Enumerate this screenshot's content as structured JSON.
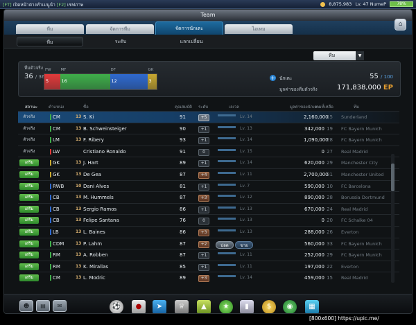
{
  "topbar": {
    "left_tag": "[FT]",
    "left_text": "เปิดหน้าต่างทำเมนูนำ",
    "left_tag2": "[F2]",
    "left_text2": "เซฟภาพ",
    "coins": "8,875,983",
    "level": "Lv. 47 NumeP",
    "battery": "78%"
  },
  "window": {
    "title": "Team"
  },
  "main_tabs": [
    "ทีม",
    "จัดการทีม",
    "จัดการนักเตะ",
    "ไอเทม"
  ],
  "sub_tabs": [
    "ทีม",
    "ระดับ",
    "แลกเปลี่ยน"
  ],
  "team_select": {
    "value": "ทีม"
  },
  "summary": {
    "squad_label": "ทีมตัวจริง",
    "squad_count": "36",
    "squad_max": "/ 36",
    "positions": [
      {
        "label": "FW",
        "count": "5",
        "color": "#e23a3a"
      },
      {
        "label": "MF",
        "count": "16",
        "color": "#3fae4a"
      },
      {
        "label": "DF",
        "count": "12",
        "color": "#2f6ad0"
      },
      {
        "label": "GK",
        "count": "3",
        "color": "#c8a830"
      }
    ],
    "player_label": "นักเตะ",
    "player_count": "55",
    "player_max": "/ 100",
    "value_label": "มูลค่าของทีมตัวจริง",
    "value": "171,838,000",
    "value_unit": "EP"
  },
  "table": {
    "headers": {
      "status": "สถานะ",
      "position": "ตำแหน่ง",
      "name": "ชื่อ",
      "ovr": "คุณสมบัติ",
      "level": "ระดับ",
      "exp": "เลเวล",
      "price": "มูลค่าของนักเตะ",
      "season": "เกมที่เหลือ",
      "club": "ทีม"
    },
    "actions": {
      "cancel": "ปลด",
      "sell": "ขาย"
    },
    "rows": [
      {
        "status": "ตัวจริง",
        "pos": "CM",
        "flag": "13",
        "name": "S. Ki",
        "ovr": "91",
        "lvl": "+5",
        "lvl_type": "max",
        "exp": "Lv. 14",
        "price": "2,160,000",
        "season": "15",
        "club": "Sunderland",
        "pos_color": "#3fae4a",
        "selected": true
      },
      {
        "status": "ตัวจริง",
        "pos": "CM",
        "flag": "13",
        "name": "B. Schweinsteiger",
        "ovr": "90",
        "lvl": "+1",
        "lvl_type": "",
        "exp": "Lv. 13",
        "price": "342,000",
        "season": "19",
        "club": "FC Bayern Munich",
        "pos_color": "#3fae4a"
      },
      {
        "status": "ตัวจริง",
        "pos": "LM",
        "flag": "13",
        "name": "F. Ribery",
        "ovr": "93",
        "lvl": "+1",
        "lvl_type": "",
        "exp": "Lv. 14",
        "price": "1,090,000",
        "season": "28",
        "club": "FC Bayern Munich",
        "pos_color": "#3fae4a"
      },
      {
        "status": "ตัวจริง",
        "pos": "LW",
        "flag": "",
        "name": "Cristiano Ronaldo",
        "ovr": "91",
        "lvl": "0",
        "lvl_type": "",
        "exp": "Lv. 15",
        "price": "0",
        "season": "27",
        "club": "Real Madrid",
        "pos_color": "#e23a3a"
      },
      {
        "status": "เสริม",
        "pos": "GK",
        "flag": "13",
        "name": "J. Hart",
        "ovr": "89",
        "lvl": "+1",
        "lvl_type": "",
        "exp": "Lv. 14",
        "price": "620,000",
        "season": "29",
        "club": "Manchester City",
        "pos_color": "#c8a830"
      },
      {
        "status": "เสริม",
        "pos": "GK",
        "flag": "13",
        "name": "De Gea",
        "ovr": "87",
        "lvl": "+4",
        "lvl_type": "hi",
        "exp": "Lv. 11",
        "price": "2,700,000",
        "season": "31",
        "club": "Manchester United",
        "pos_color": "#c8a830"
      },
      {
        "status": "เสริม",
        "pos": "RWB",
        "flag": "10",
        "name": "Dani Alves",
        "ovr": "81",
        "lvl": "+1",
        "lvl_type": "",
        "exp": "Lv. 7",
        "price": "590,000",
        "season": "10",
        "club": "FC Barcelona",
        "pos_color": "#2f6ad0"
      },
      {
        "status": "เสริม",
        "pos": "CB",
        "flag": "13",
        "name": "M. Hummels",
        "ovr": "87",
        "lvl": "+3",
        "lvl_type": "hi",
        "exp": "Lv. 12",
        "price": "890,000",
        "season": "28",
        "club": "Borussia Dortmund",
        "pos_color": "#2f6ad0"
      },
      {
        "status": "เสริม",
        "pos": "CB",
        "flag": "13",
        "name": "Sergio Ramos",
        "ovr": "86",
        "lvl": "+1",
        "lvl_type": "",
        "exp": "Lv. 13",
        "price": "670,000",
        "season": "24",
        "club": "Real Madrid",
        "pos_color": "#2f6ad0"
      },
      {
        "status": "เสริม",
        "pos": "CB",
        "flag": "13",
        "name": "Felipe Santana",
        "ovr": "76",
        "lvl": "0",
        "lvl_type": "",
        "exp": "Lv. 13",
        "price": "0",
        "season": "20",
        "club": "FC Schalke 04",
        "pos_color": "#2f6ad0"
      },
      {
        "status": "เสริม",
        "pos": "LB",
        "flag": "13",
        "name": "L. Baines",
        "ovr": "86",
        "lvl": "+3",
        "lvl_type": "hi",
        "exp": "Lv. 13",
        "price": "288,000",
        "season": "26",
        "club": "Everton",
        "pos_color": "#2f6ad0"
      },
      {
        "status": "เสริม",
        "pos": "CDM",
        "flag": "13",
        "name": "P. Lahm",
        "ovr": "87",
        "lvl": "+2",
        "lvl_type": "hi",
        "exp": "",
        "price": "560,000",
        "season": "33",
        "club": "FC Bayern Munich",
        "pos_color": "#3fae4a",
        "actions": true
      },
      {
        "status": "เสริม",
        "pos": "RM",
        "flag": "13",
        "name": "A. Robben",
        "ovr": "87",
        "lvl": "+1",
        "lvl_type": "",
        "exp": "Lv. 11",
        "price": "252,000",
        "season": "29",
        "club": "FC Bayern Munich",
        "pos_color": "#3fae4a"
      },
      {
        "status": "เสริม",
        "pos": "RM",
        "flag": "13",
        "name": "K. Mirallas",
        "ovr": "85",
        "lvl": "+1",
        "lvl_type": "",
        "exp": "Lv. 11",
        "price": "197,000",
        "season": "22",
        "club": "Everton",
        "pos_color": "#3fae4a"
      },
      {
        "status": "เสริม",
        "pos": "CM",
        "flag": "13",
        "name": "L. Modric",
        "ovr": "89",
        "lvl": "+3",
        "lvl_type": "hi",
        "exp": "Lv. 14",
        "price": "459,000",
        "season": "15",
        "club": "Real Madrid",
        "pos_color": "#3fae4a"
      }
    ]
  },
  "dock": {
    "icons": [
      "profile-card-icon",
      "lineup-icon",
      "message-icon",
      "football-icon",
      "shoe-icon",
      "boot-icon",
      "trophy-icon",
      "cone-icon",
      "league-badge-icon",
      "card-pack-icon",
      "coin-shop-icon",
      "club-badge-icon",
      "basket-icon"
    ]
  },
  "watermark": "[800x600] https://upic.me/"
}
